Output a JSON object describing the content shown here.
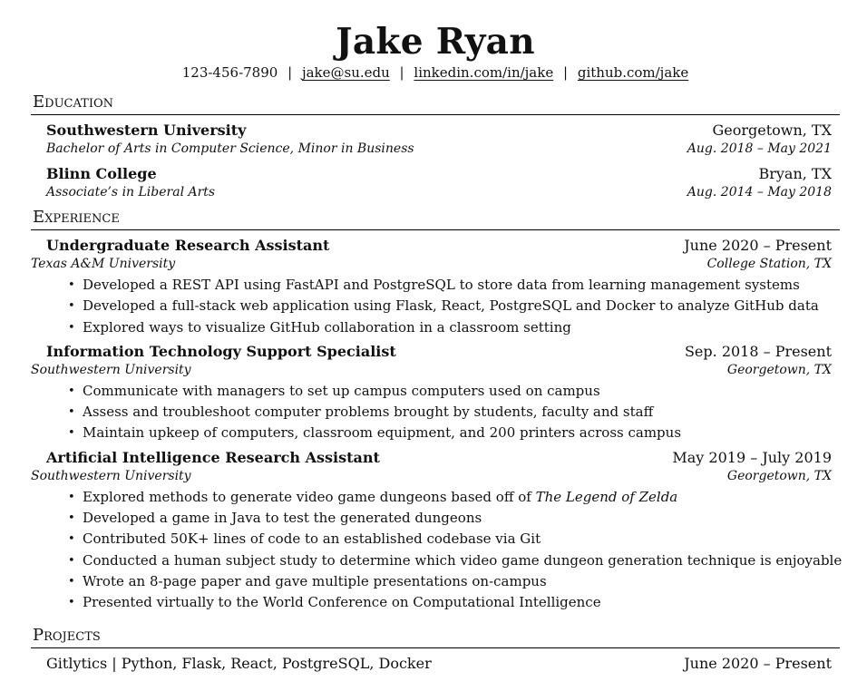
{
  "name": "Jake Ryan",
  "contact": {
    "phone": "123-456-7890",
    "email": "jake@su.edu",
    "linkedin": "linkedin.com/in/jake",
    "github": "github.com/jake",
    "separator": "|"
  },
  "sections": {
    "education": "Education",
    "experience": "Experience",
    "projects": "Projects"
  },
  "education": [
    {
      "school": "Southwestern University",
      "location": "Georgetown, TX",
      "degree": "Bachelor of Arts in Computer Science, Minor in Business",
      "dates": "Aug. 2018 – May 2021"
    },
    {
      "school": "Blinn College",
      "location": "Bryan, TX",
      "degree": "Associate’s in Liberal Arts",
      "dates": "Aug. 2014 – May 2018"
    }
  ],
  "experience": [
    {
      "title": "Undergraduate Research Assistant",
      "dates": "June 2020 – Present",
      "org": "Texas A&M University",
      "location": "College Station, TX",
      "bullets": [
        "Developed a REST API using FastAPI and PostgreSQL to store data from learning management systems",
        "Developed a full-stack web application using Flask, React, PostgreSQL and Docker to analyze GitHub data",
        "Explored ways to visualize GitHub collaboration in a classroom setting"
      ]
    },
    {
      "title": "Information Technology Support Specialist",
      "dates": "Sep. 2018 – Present",
      "org": "Southwestern University",
      "location": "Georgetown, TX",
      "bullets": [
        "Communicate with managers to set up campus computers used on campus",
        "Assess and troubleshoot computer problems brought by students, faculty and staff",
        "Maintain upkeep of computers, classroom equipment, and 200 printers across campus"
      ]
    },
    {
      "title": "Artificial Intelligence Research Assistant",
      "dates": "May 2019 – July 2019",
      "org": "Southwestern University",
      "location": "Georgetown, TX",
      "bullets": [
        "Explored methods to generate video game dungeons based off of ",
        "Developed a game in Java to test the generated dungeons",
        "Contributed 50K+ lines of code to an established codebase via Git",
        "Conducted a human subject study to determine which video game dungeon generation technique is enjoyable",
        "Wrote an 8-page paper and gave multiple presentations on-campus",
        "Presented virtually to the World Conference on Computational Intelligence"
      ],
      "bullet_0_italic": "The Legend of Zelda"
    }
  ],
  "projects_partial": {
    "left": "Gitlytics | Python, Flask, React, PostgreSQL, Docker",
    "right": "June 2020 – Present"
  }
}
